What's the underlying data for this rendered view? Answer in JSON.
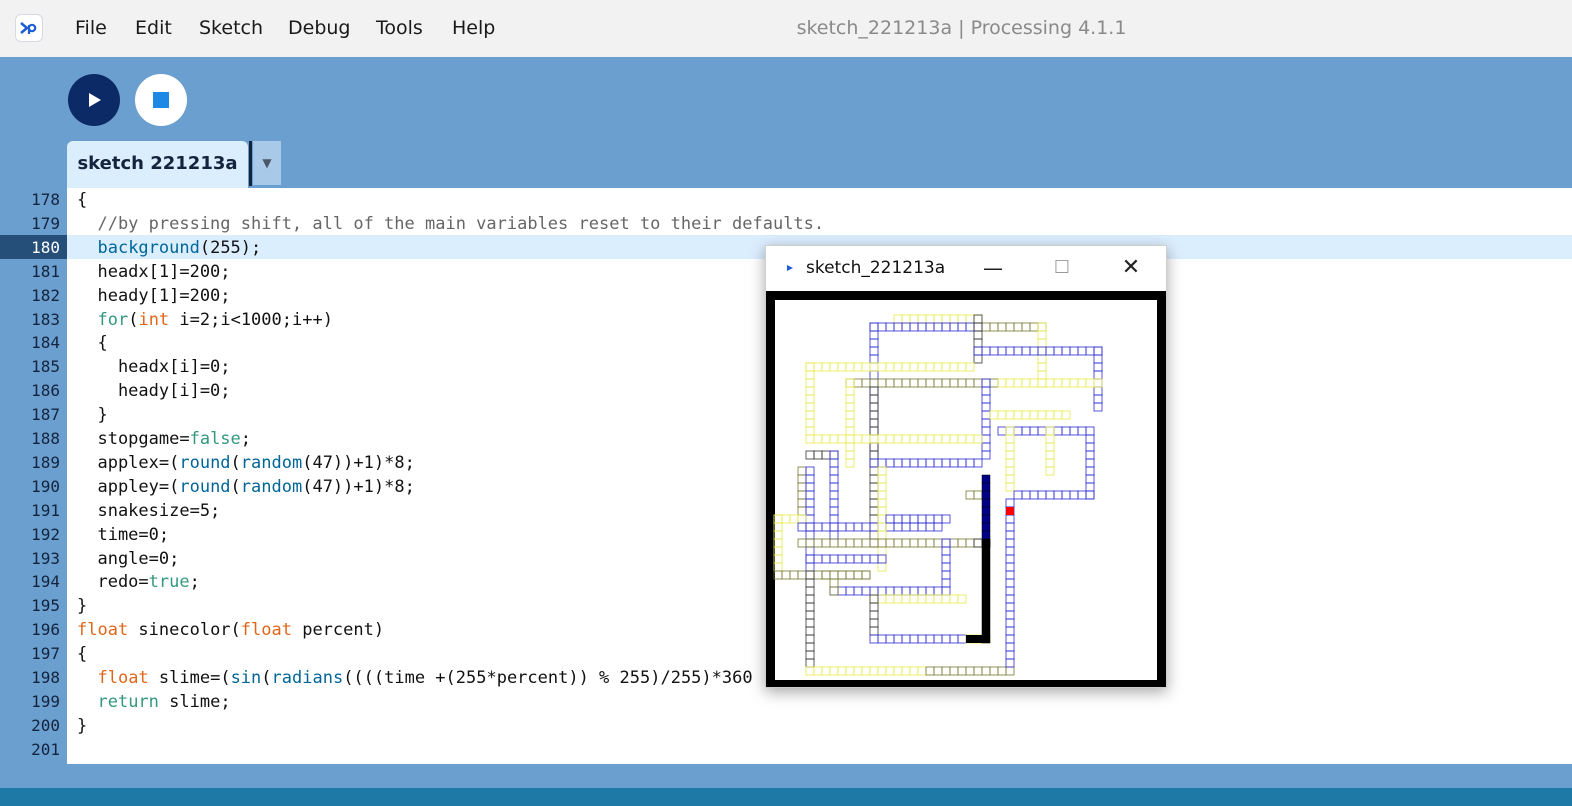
{
  "menubar": {
    "items": [
      "File",
      "Edit",
      "Sketch",
      "Debug",
      "Tools",
      "Help"
    ],
    "window_title": "sketch_221213a | Processing 4.1.1"
  },
  "toolbar": {
    "run_icon": "play-icon",
    "stop_icon": "stop-icon"
  },
  "tabs": [
    {
      "label": "sketch 221213a"
    }
  ],
  "editor": {
    "current_line": 180,
    "lines": [
      {
        "num": "178",
        "text": "{"
      },
      {
        "num": "179",
        "text": "  //by pressing shift, all of the main variables reset to their defaults."
      },
      {
        "num": "180",
        "text": "  background(255);"
      },
      {
        "num": "181",
        "text": "  headx[1]=200;"
      },
      {
        "num": "182",
        "text": "  heady[1]=200;"
      },
      {
        "num": "183",
        "text": "  for(int i=2;i<1000;i++)"
      },
      {
        "num": "184",
        "text": "  {"
      },
      {
        "num": "185",
        "text": "    headx[i]=0;"
      },
      {
        "num": "186",
        "text": "    heady[i]=0;"
      },
      {
        "num": "187",
        "text": "  }"
      },
      {
        "num": "188",
        "text": "  stopgame=false;"
      },
      {
        "num": "189",
        "text": "  applex=(round(random(47))+1)*8;"
      },
      {
        "num": "190",
        "text": "  appley=(round(random(47))+1)*8;"
      },
      {
        "num": "191",
        "text": "  snakesize=5;"
      },
      {
        "num": "192",
        "text": "  time=0;"
      },
      {
        "num": "193",
        "text": "  angle=0;"
      },
      {
        "num": "194",
        "text": "  redo=true;"
      },
      {
        "num": "195",
        "text": "}"
      },
      {
        "num": "196",
        "text": "float sinecolor(float percent)"
      },
      {
        "num": "197",
        "text": "{"
      },
      {
        "num": "198",
        "text": "  float slime=(sin(radians((((time +(255*percent)) % 255)/255)*360"
      },
      {
        "num": "199",
        "text": "  return slime;"
      },
      {
        "num": "200",
        "text": "}"
      },
      {
        "num": "201",
        "text": ""
      }
    ]
  },
  "sketch_window": {
    "title": "sketch_221213a",
    "minimize_icon": "minimize-icon",
    "maximize_icon": "maximize-icon",
    "close_icon": "close-icon"
  },
  "colors": {
    "toolbar_bg": "#6b9fcf",
    "run_button": "#0b2a66",
    "stop_square": "#1e88e5",
    "tab_bg": "#dbeefe",
    "keyword_green": "#33997e",
    "keyword_orange": "#e2661a",
    "function_blue": "#006699",
    "status_bar": "#1f79a6",
    "apple_red": "#ff0000"
  }
}
